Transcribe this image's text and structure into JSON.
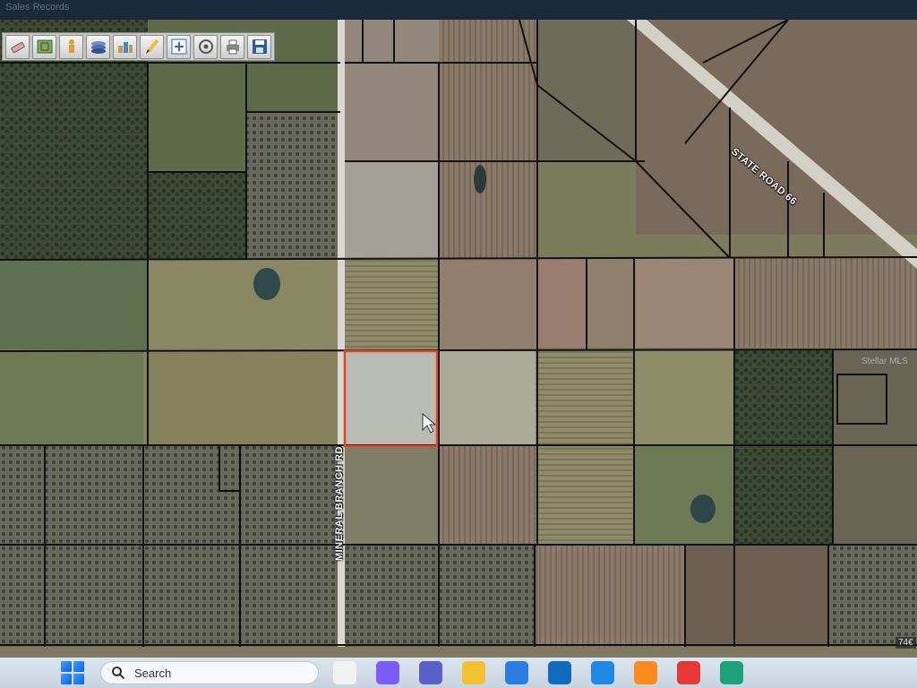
{
  "window": {
    "tab_text": "Sales Records"
  },
  "toolbar": {
    "tools": [
      {
        "name": "eraser-icon"
      },
      {
        "name": "select-map-icon"
      },
      {
        "name": "identify-icon"
      },
      {
        "name": "layers-icon"
      },
      {
        "name": "buildings-icon"
      },
      {
        "name": "pencil-icon"
      },
      {
        "name": "zoom-extent-icon"
      },
      {
        "name": "buffer-icon"
      },
      {
        "name": "print-icon"
      },
      {
        "name": "save-icon"
      }
    ]
  },
  "map": {
    "roads": [
      {
        "label": "STATE ROAD 66"
      },
      {
        "label": "MINERAL BRANCH RD"
      }
    ],
    "watermark": "Stellar MLS",
    "scale_text": "74€",
    "highlight_color": "#e0452a",
    "parcel_line_color": "#111111"
  },
  "taskbar": {
    "search_placeholder": "Search",
    "apps": [
      {
        "name": "task-view-icon",
        "color": "#f2f2f2"
      },
      {
        "name": "copilot-icon",
        "color": "#7b5cff"
      },
      {
        "name": "teams-icon",
        "color": "#5b5fc7"
      },
      {
        "name": "file-explorer-icon",
        "color": "#f2c230"
      },
      {
        "name": "store-icon",
        "color": "#2a7de1"
      },
      {
        "name": "outlook-icon",
        "color": "#0f6cbd"
      },
      {
        "name": "vscode-icon",
        "color": "#1e88e5"
      },
      {
        "name": "firefox-icon",
        "color": "#ff8a1c"
      },
      {
        "name": "chrome-icon",
        "color": "#e53935"
      },
      {
        "name": "edge-icon",
        "color": "#1aa37a"
      }
    ]
  }
}
